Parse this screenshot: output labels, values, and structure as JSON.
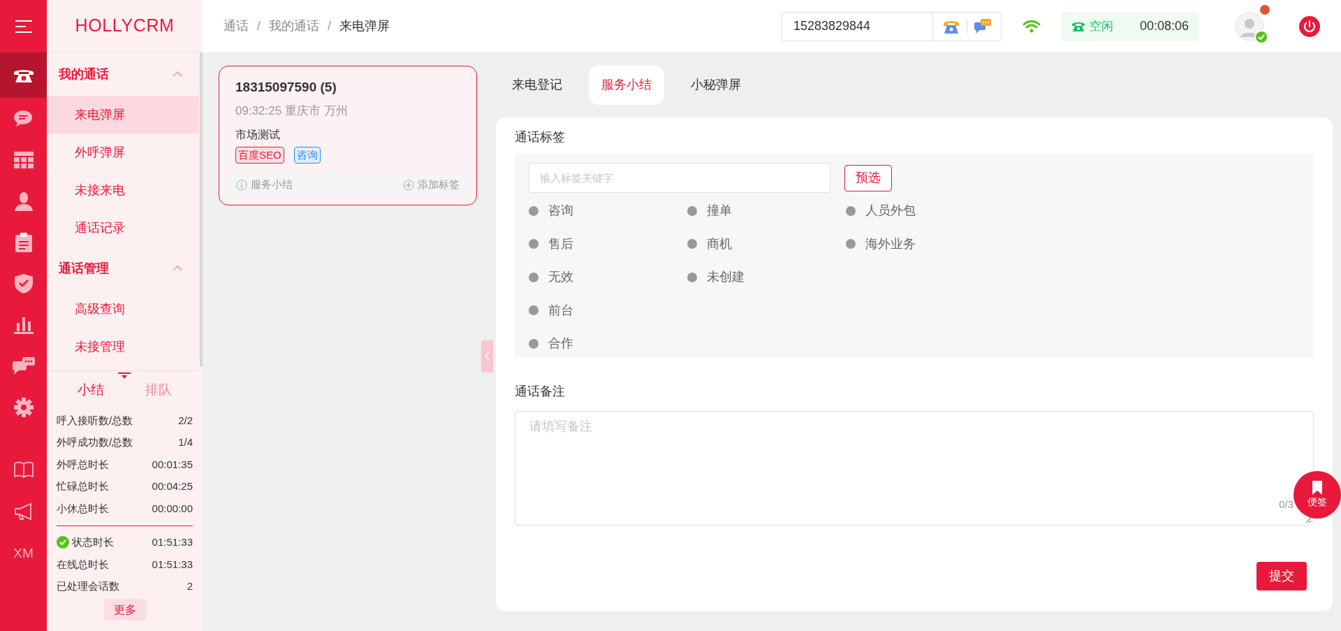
{
  "brand": "HOLLYCRM",
  "rail": {
    "items": [
      {
        "selected": true
      },
      {
        "selected": false
      },
      {
        "selected": false
      },
      {
        "selected": false
      },
      {
        "selected": false
      },
      {
        "selected": false
      },
      {
        "selected": false
      },
      {
        "selected": false
      },
      {
        "selected": false
      }
    ],
    "footer_label": "XM"
  },
  "menu": [
    {
      "label": "我的通话",
      "expanded": true,
      "children": [
        {
          "label": "来电弹屏",
          "selected": true
        },
        {
          "label": "外呼弹屏",
          "selected": false
        },
        {
          "label": "未接来电",
          "selected": false
        },
        {
          "label": "通话记录",
          "selected": false
        }
      ]
    },
    {
      "label": "通话管理",
      "expanded": true,
      "children": [
        {
          "label": "高级查询",
          "selected": false
        },
        {
          "label": "未接管理",
          "selected": false
        }
      ]
    }
  ],
  "stats": {
    "tabs": [
      {
        "label": "小结",
        "selected": true
      },
      {
        "label": "排队",
        "selected": false
      }
    ],
    "rows": [
      {
        "label": "呼入接听数/总数",
        "value": "2/2"
      },
      {
        "label": "外呼成功数/总数",
        "value": "1/4"
      },
      {
        "label": "外呼总时长",
        "value": "00:01:35"
      },
      {
        "label": "忙碌总时长",
        "value": "00:04:25"
      },
      {
        "label": "小休总时长",
        "value": "00:00:00"
      }
    ],
    "rows_after_divider": [
      {
        "label": "状态时长",
        "value": "01:51:33",
        "kind": "status"
      },
      {
        "label": "在线总时长",
        "value": "01:51:33",
        "kind": "plain"
      },
      {
        "label": "已处理会话数",
        "value": "2",
        "kind": "plain"
      }
    ],
    "more_button": "更多"
  },
  "breadcrumb": [
    "通话",
    "我的通话",
    "来电弹屏"
  ],
  "breadcrumb_separators": [
    "/",
    "/"
  ],
  "topbar": {
    "phone_number": "15283829844",
    "status": "空闲",
    "timer": "00:08:06",
    "notification": true,
    "online": true
  },
  "call_card": {
    "title": "18315097590 (5)",
    "subtitle": "09:32:25 重庆市 万州",
    "note": "市场测试",
    "tags": [
      {
        "label": "百度SEO",
        "color": "#e8193a"
      },
      {
        "label": "咨询",
        "color": "#1890ff"
      }
    ],
    "actions": [
      "服务小结",
      "添加标签"
    ]
  },
  "tabs": [
    {
      "label": "来电登记",
      "selected": false
    },
    {
      "label": "服务小结",
      "selected": true
    },
    {
      "label": "小秘弹屏",
      "selected": false
    }
  ],
  "tag_section": {
    "title": "通话标签",
    "search_placeholder": "输入标签关键字",
    "preset_button": "预选",
    "columns": [
      [
        {
          "label": "咨询",
          "selected": false
        },
        {
          "label": "售后",
          "selected": false
        },
        {
          "label": "无效",
          "selected": false
        },
        {
          "label": "前台",
          "selected": false
        },
        {
          "label": "合作",
          "selected": false
        }
      ],
      [
        {
          "label": "撞单",
          "selected": false
        },
        {
          "label": "商机",
          "selected": false
        },
        {
          "label": "未创建",
          "selected": false
        }
      ],
      [
        {
          "label": "人员外包",
          "selected": false
        },
        {
          "label": "海外业务",
          "selected": false
        }
      ]
    ]
  },
  "remark_section": {
    "title": "通话备注",
    "placeholder": "请填写备注",
    "counter": "0/3"
  },
  "submit_button": "提交",
  "floating_button": "便签"
}
